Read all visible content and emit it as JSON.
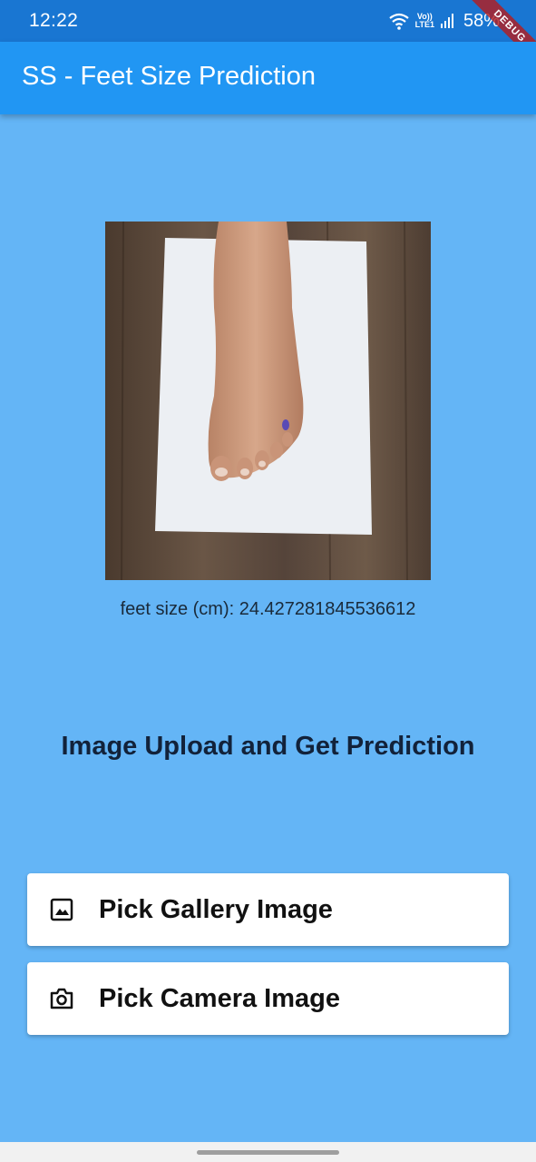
{
  "status_bar": {
    "time": "12:22",
    "lte_top": "Vo))",
    "lte_bottom": "LTE1",
    "battery": "58%"
  },
  "debug_banner": "DEBUG",
  "app_bar": {
    "title": "SS - Feet Size Prediction"
  },
  "main": {
    "image_description": "foot-on-paper-photo",
    "result_text": "feet size (cm): 24.427281845536612",
    "heading": "Image Upload and Get Prediction"
  },
  "buttons": {
    "gallery": {
      "label": "Pick Gallery Image",
      "icon": "image-icon"
    },
    "camera": {
      "label": "Pick Camera Image",
      "icon": "camera-icon"
    }
  },
  "colors": {
    "background": "#64B5F6",
    "app_bar": "#2196F3",
    "status_bar": "#1976D2"
  }
}
